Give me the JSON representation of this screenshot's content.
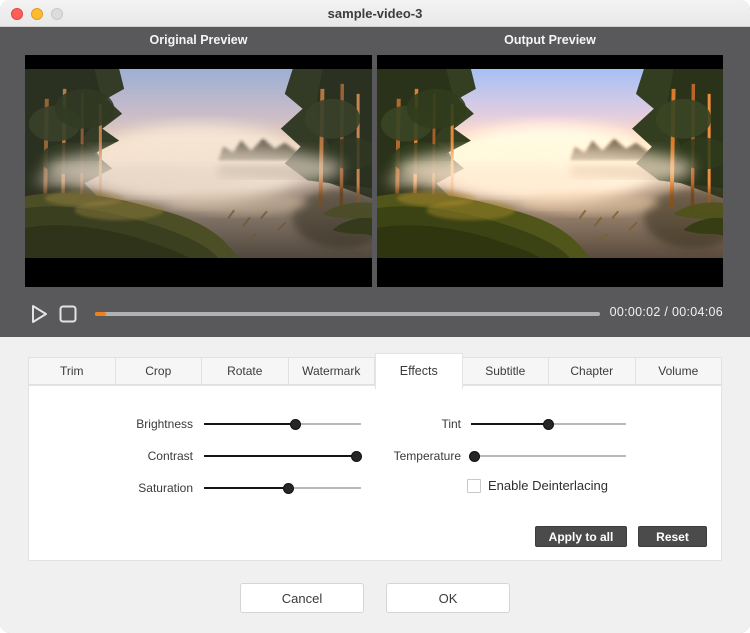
{
  "window": {
    "title": "sample-video-3"
  },
  "preview": {
    "original_label": "Original Preview",
    "output_label": "Output Preview"
  },
  "playback": {
    "time_display": "00:00:02 / 00:04:06",
    "progress_pct": 2.2,
    "accent_color": "#f08119"
  },
  "tabs": [
    {
      "label": "Trim"
    },
    {
      "label": "Crop"
    },
    {
      "label": "Rotate"
    },
    {
      "label": "Watermark"
    },
    {
      "label": "Effects",
      "active": true
    },
    {
      "label": "Subtitle"
    },
    {
      "label": "Chapter"
    },
    {
      "label": "Volume"
    }
  ],
  "effects": {
    "sliders": [
      {
        "label": "Brightness",
        "value_pct": 58
      },
      {
        "label": "Contrast",
        "value_pct": 97
      },
      {
        "label": "Saturation",
        "value_pct": 54
      },
      {
        "label": "Tint",
        "value_pct": 50
      },
      {
        "label": "Temperature",
        "value_pct": 2
      }
    ],
    "checkbox": {
      "label": "Enable Deinterlacing",
      "checked": false
    },
    "apply_label": "Apply to all",
    "reset_label": "Reset"
  },
  "footer": {
    "cancel_label": "Cancel",
    "ok_label": "OK"
  }
}
